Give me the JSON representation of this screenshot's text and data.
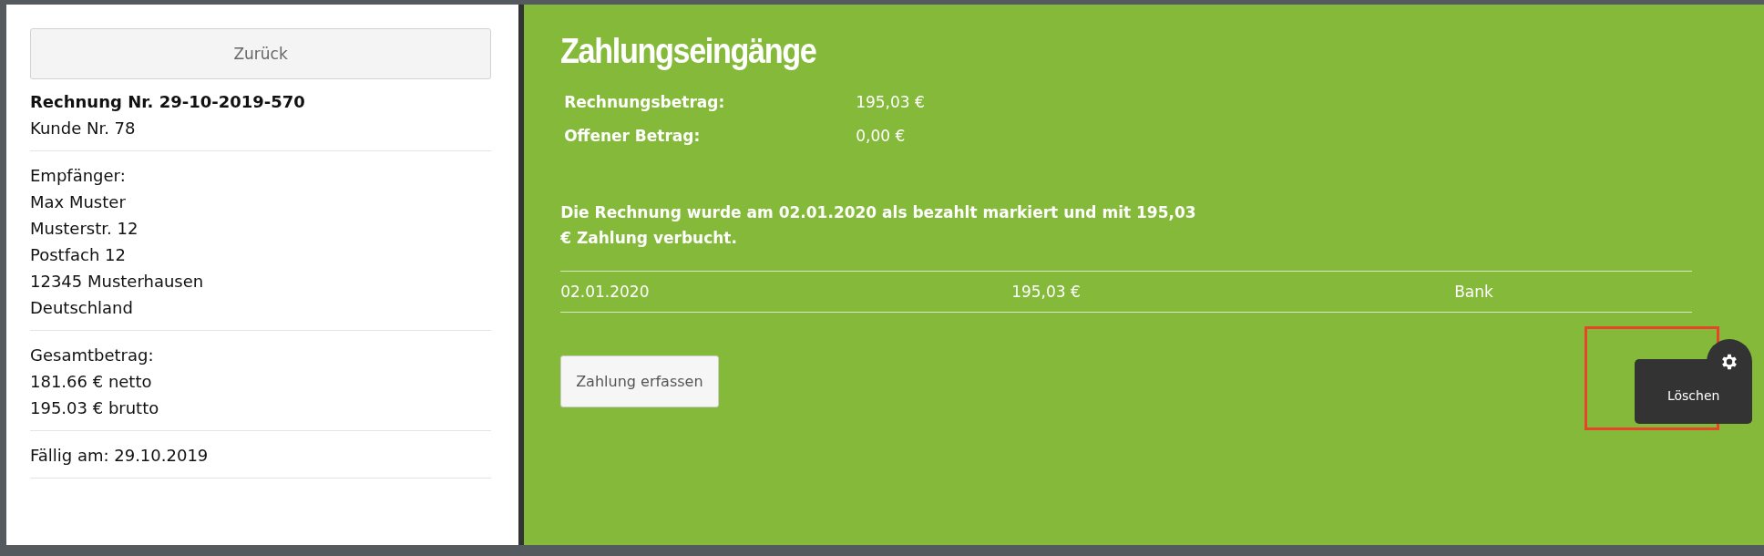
{
  "sidebar": {
    "back_button": "Zurück",
    "invoice_title": "Rechnung Nr. 29-10-2019-570",
    "customer": "Kunde Nr. 78",
    "recipient": [
      "Empfänger:",
      "Max Muster",
      "Musterstr. 12",
      "Postfach 12",
      "12345 Musterhausen",
      "Deutschland"
    ],
    "total": [
      "Gesamtbetrag:",
      "181.66 € netto",
      "195.03 € brutto"
    ],
    "due": "Fällig am: 29.10.2019"
  },
  "payments": {
    "title": "Zahlungseingänge",
    "summary": [
      {
        "label": "Rechnungsbetrag:",
        "value": "195,03 €"
      },
      {
        "label": "Offener Betrag:",
        "value": "0,00 €"
      }
    ],
    "message": "Die Rechnung wurde am 02.01.2020 als bezahlt markiert und mit 195,03 € Zahlung verbucht.",
    "rows": [
      {
        "date": "02.01.2020",
        "amount": "195,03 €",
        "method": "Bank"
      }
    ],
    "add_button": "Zahlung erfassen"
  },
  "row_menu": {
    "items": [
      "Löschen"
    ]
  }
}
